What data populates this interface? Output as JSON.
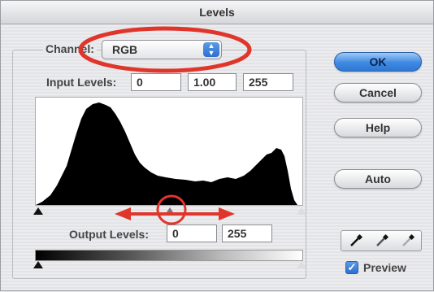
{
  "window": {
    "title": "Levels"
  },
  "channel": {
    "label": "Channel:",
    "value": "RGB"
  },
  "input_levels": {
    "label": "Input Levels:",
    "black": "0",
    "gamma": "1.00",
    "white": "255"
  },
  "output_levels": {
    "label": "Output Levels:",
    "black": "0",
    "white": "255"
  },
  "buttons": {
    "ok": "OK",
    "cancel": "Cancel",
    "help": "Help",
    "auto": "Auto"
  },
  "preview": {
    "label": "Preview",
    "checked": true
  },
  "colors": {
    "annotation": "#e0352b",
    "accent": "#2f78d4"
  },
  "icons": [
    "eyedropper-black-icon",
    "eyedropper-gray-icon",
    "eyedropper-white-icon",
    "chevron-updown-icon",
    "checkmark-icon"
  ]
}
